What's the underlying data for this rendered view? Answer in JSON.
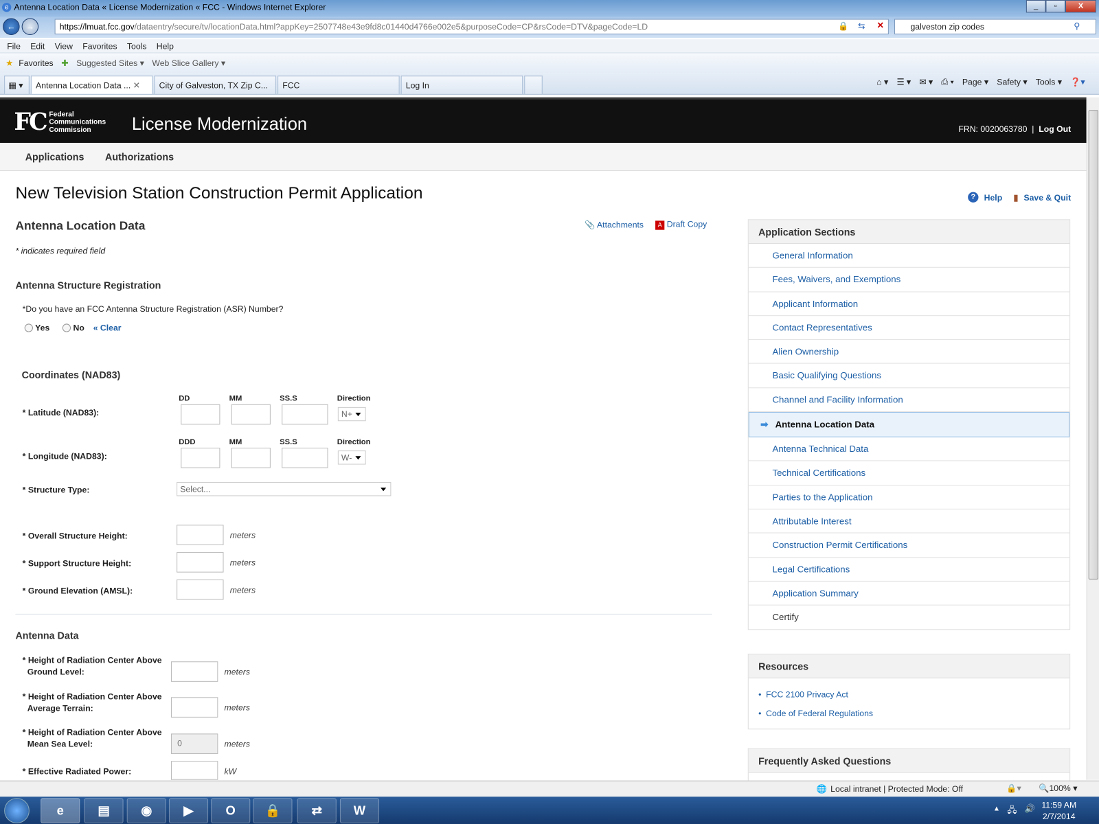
{
  "browser": {
    "window_title": "Antenna Location Data « License Modernization « FCC - Windows Internet Explorer",
    "url_host": "https://lmuat.fcc.gov",
    "url_rest": "/dataentry/secure/tv/locationData.html?appKey=2507748e43e9fd8c01440d4766e002e5&purposeCode=CP&rsCode=DTV&pageCode=LD",
    "search_value": "galveston zip codes",
    "menu": [
      "File",
      "Edit",
      "View",
      "Favorites",
      "Tools",
      "Help"
    ],
    "favorites": {
      "favorites": "Favorites",
      "suggested": "Suggested Sites ▾",
      "webslice": "Web Slice Gallery ▾"
    },
    "tabs": [
      "Antenna Location Data ...",
      "City of Galveston, TX Zip C...",
      "FCC",
      "Log In"
    ],
    "commands": [
      "Page ▾",
      "Safety ▾",
      "Tools ▾"
    ],
    "status": "Local intranet | Protected Mode: Off",
    "zoom": "100%"
  },
  "header": {
    "logo_mark": "FCC",
    "logo_text": [
      "Federal",
      "Communications",
      "Commission"
    ],
    "app_title": "License Modernization",
    "frn": "FRN: 0020063780",
    "separator": "|",
    "logout": "Log Out"
  },
  "nav": [
    "Applications",
    "Authorizations"
  ],
  "page": {
    "title": "New Television Station Construction Permit Application",
    "help": "Help",
    "save_quit": "Save & Quit",
    "section_title": "Antenna Location Data",
    "attachments": "Attachments",
    "draft_copy": "Draft Copy",
    "required_note": "* indicates required field"
  },
  "asr": {
    "heading": "Antenna Structure Registration",
    "question": "*Do you have an FCC Antenna Structure Registration (ASR) Number?",
    "yes": "Yes",
    "no": "No",
    "clear": "« Clear"
  },
  "coords": {
    "heading": "Coordinates (NAD83)",
    "lat": {
      "label": "* Latitude (NAD83):",
      "cols": [
        "DD",
        "MM",
        "SS.S",
        "Direction"
      ],
      "direction": "N+"
    },
    "lon": {
      "label": "* Longitude (NAD83):",
      "cols": [
        "DDD",
        "MM",
        "SS.S",
        "Direction"
      ],
      "direction": "W-"
    },
    "structure_type": {
      "label": "* Structure Type:",
      "value": "Select..."
    },
    "heights": [
      {
        "label": "* Overall Structure Height:",
        "unit": "meters"
      },
      {
        "label": "* Support Structure Height:",
        "unit": "meters"
      },
      {
        "label": "* Ground Elevation (AMSL):",
        "unit": "meters"
      }
    ]
  },
  "antenna": {
    "heading": "Antenna Data",
    "rows": [
      {
        "label1": "* Height of Radiation Center Above",
        "label2": "Ground Level:",
        "unit": "meters",
        "value": ""
      },
      {
        "label1": "* Height of Radiation Center Above",
        "label2": "Average Terrain:",
        "unit": "meters",
        "value": ""
      },
      {
        "label1": "* Height of Radiation Center Above",
        "label2": "Mean Sea Level:",
        "unit": "meters",
        "value": "0"
      },
      {
        "label1": "* Effective Radiated Power:",
        "label2": "",
        "unit": "kW",
        "value": ""
      }
    ]
  },
  "sidebar": {
    "heading": "Application Sections",
    "items": [
      "General Information",
      "Fees, Waivers, and Exemptions",
      "Applicant Information",
      "Contact Representatives",
      "Alien Ownership",
      "Basic Qualifying Questions",
      "Channel and Facility Information",
      "Antenna Location Data",
      "Antenna Technical Data",
      "Technical Certifications",
      "Parties to the Application",
      "Attributable Interest",
      "Construction Permit Certifications",
      "Legal Certifications",
      "Application Summary",
      "Certify"
    ],
    "current": "Antenna Location Data"
  },
  "resources": {
    "heading": "Resources",
    "items": [
      "FCC 2100 Privacy Act",
      "Code of Federal Regulations"
    ]
  },
  "faq": {
    "heading": "Frequently Asked Questions"
  },
  "clock": {
    "time": "11:59 AM",
    "date": "2/7/2014"
  }
}
